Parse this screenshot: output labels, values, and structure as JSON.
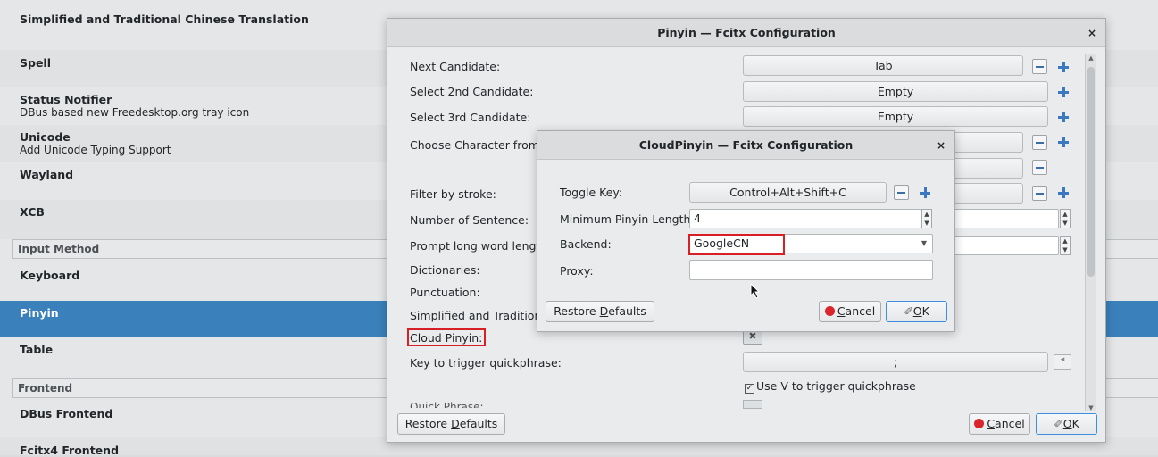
{
  "addons": [
    {
      "name": "Simplified and Traditional Chinese Translation",
      "desc": ""
    },
    {
      "name": "Spell",
      "desc": ""
    },
    {
      "name": "Status Notifier",
      "desc": "DBus based new Freedesktop.org tray icon"
    },
    {
      "name": "Unicode",
      "desc": "Add Unicode Typing Support"
    },
    {
      "name": "Wayland",
      "desc": ""
    },
    {
      "name": "XCB",
      "desc": ""
    }
  ],
  "sections": {
    "input_method": "Input Method",
    "frontend": "Frontend"
  },
  "input_methods": [
    {
      "name": "Keyboard"
    },
    {
      "name": "Pinyin"
    },
    {
      "name": "Table"
    }
  ],
  "frontends": [
    {
      "name": "DBus Frontend"
    },
    {
      "name": "Fcitx4 Frontend"
    }
  ],
  "pinyin_window": {
    "title": "Pinyin — Fcitx Configuration",
    "close": "×",
    "rows": {
      "next_candidate": "Next Candidate:",
      "select_2nd": "Select 2nd Candidate:",
      "select_3rd": "Select 3rd Candidate:",
      "choose_char": "Choose Character from P",
      "filter_stroke": "Filter by stroke:",
      "num_sentence": "Number of Sentence:",
      "prompt_long": "Prompt long word length",
      "dictionaries": "Dictionaries:",
      "punctuation": "Punctuation:",
      "simp_trad": "Simplified and Traditiona",
      "cloud_pinyin": "Cloud Pinyin:",
      "key_quickphrase": "Key to trigger quickphrase:",
      "quick_phrase": "Quick Phrase:"
    },
    "values": {
      "next_candidate": "Tab",
      "select_2nd": "Empty",
      "select_3rd": "Empty",
      "quickphrase_key": ";",
      "use_v": "Use V to trigger quickphrase"
    },
    "buttons": {
      "restore_pre": "Restore ",
      "restore_u": "D",
      "restore_post": "efaults",
      "cancel_u": "C",
      "cancel_post": "ancel",
      "ok_u": "O",
      "ok_post": "K"
    }
  },
  "cloud_window": {
    "title": "CloudPinyin — Fcitx Configuration",
    "close": "×",
    "labels": {
      "toggle_key": "Toggle Key:",
      "min_length": "Minimum Pinyin Length:",
      "backend": "Backend:",
      "proxy": "Proxy:"
    },
    "values": {
      "toggle_key": "Control+Alt+Shift+C",
      "min_length": "4",
      "backend": "GoogleCN",
      "proxy": ""
    },
    "buttons": {
      "restore_pre": "Restore ",
      "restore_u": "D",
      "restore_post": "efaults",
      "cancel_u": "C",
      "cancel_post": "ancel",
      "ok_u": "O",
      "ok_post": "K"
    }
  }
}
